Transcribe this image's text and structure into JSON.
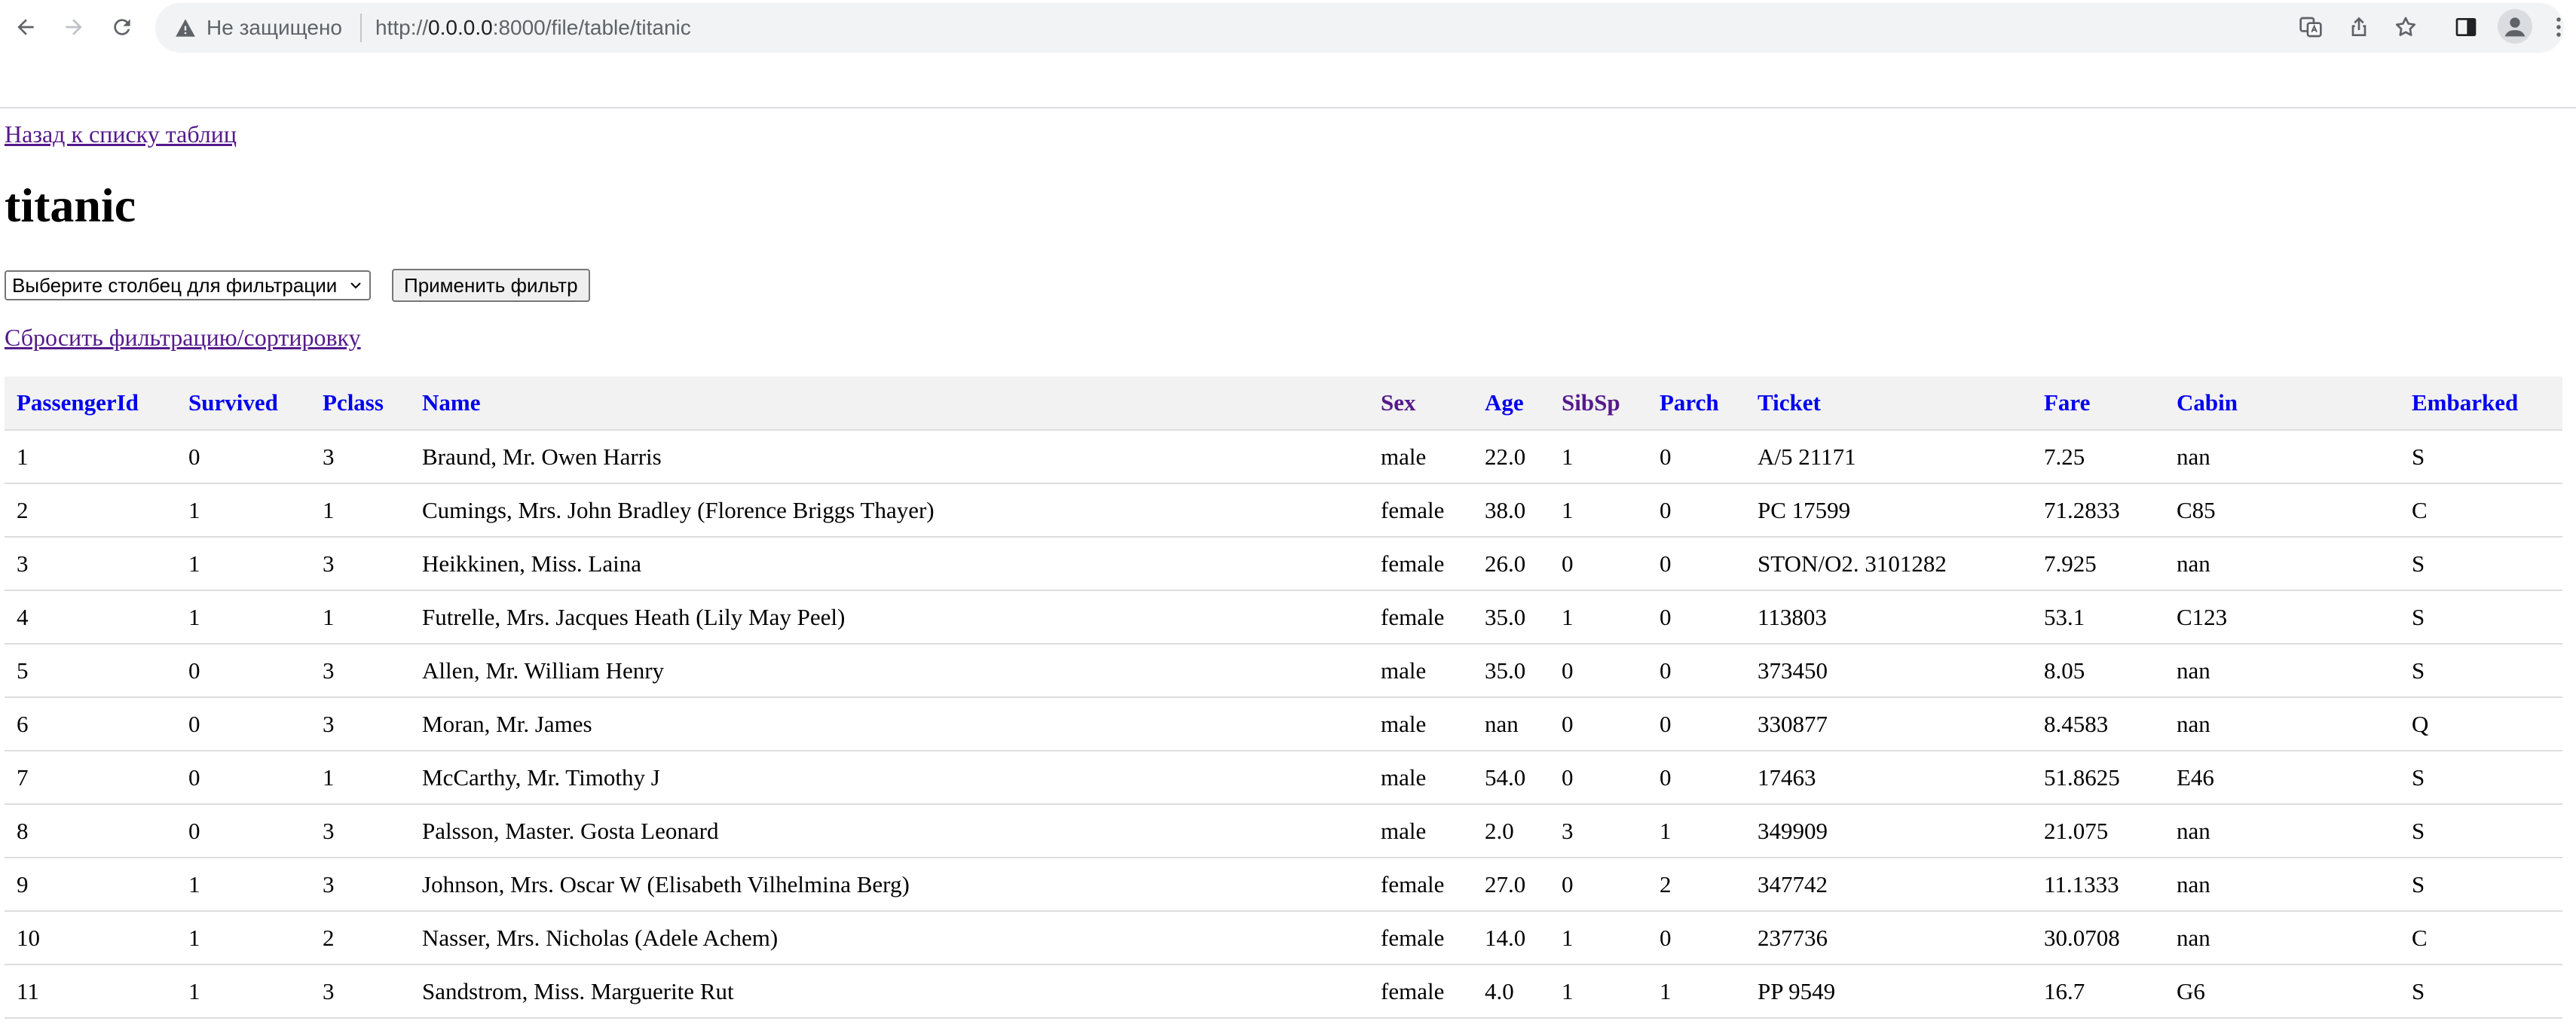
{
  "browser": {
    "security_label": "Не защищено",
    "url_prefix": "http://",
    "url_host": "0.0.0.0",
    "url_path": ":8000/file/table/titanic"
  },
  "page": {
    "back_link": "Назад к списку таблиц",
    "title": "titanic",
    "filter_select": "Выберите столбец для фильтрации",
    "apply_button": "Применить фильтр",
    "reset_link": "Сбросить фильтрацию/сортировку"
  },
  "table": {
    "columns": [
      "PassengerId",
      "Survived",
      "Pclass",
      "Name",
      "Sex",
      "Age",
      "SibSp",
      "Parch",
      "Ticket",
      "Fare",
      "Cabin",
      "Embarked"
    ],
    "rows": [
      [
        "1",
        "0",
        "3",
        "Braund, Mr. Owen Harris",
        "male",
        "22.0",
        "1",
        "0",
        "A/5 21171",
        "7.25",
        "nan",
        "S"
      ],
      [
        "2",
        "1",
        "1",
        "Cumings, Mrs. John Bradley (Florence Briggs Thayer)",
        "female",
        "38.0",
        "1",
        "0",
        "PC 17599",
        "71.2833",
        "C85",
        "C"
      ],
      [
        "3",
        "1",
        "3",
        "Heikkinen, Miss. Laina",
        "female",
        "26.0",
        "0",
        "0",
        "STON/O2. 3101282",
        "7.925",
        "nan",
        "S"
      ],
      [
        "4",
        "1",
        "1",
        "Futrelle, Mrs. Jacques Heath (Lily May Peel)",
        "female",
        "35.0",
        "1",
        "0",
        "113803",
        "53.1",
        "C123",
        "S"
      ],
      [
        "5",
        "0",
        "3",
        "Allen, Mr. William Henry",
        "male",
        "35.0",
        "0",
        "0",
        "373450",
        "8.05",
        "nan",
        "S"
      ],
      [
        "6",
        "0",
        "3",
        "Moran, Mr. James",
        "male",
        "nan",
        "0",
        "0",
        "330877",
        "8.4583",
        "nan",
        "Q"
      ],
      [
        "7",
        "0",
        "1",
        "McCarthy, Mr. Timothy J",
        "male",
        "54.0",
        "0",
        "0",
        "17463",
        "51.8625",
        "E46",
        "S"
      ],
      [
        "8",
        "0",
        "3",
        "Palsson, Master. Gosta Leonard",
        "male",
        "2.0",
        "3",
        "1",
        "349909",
        "21.075",
        "nan",
        "S"
      ],
      [
        "9",
        "1",
        "3",
        "Johnson, Mrs. Oscar W (Elisabeth Vilhelmina Berg)",
        "female",
        "27.0",
        "0",
        "2",
        "347742",
        "11.1333",
        "nan",
        "S"
      ],
      [
        "10",
        "1",
        "2",
        "Nasser, Mrs. Nicholas (Adele Achem)",
        "female",
        "14.0",
        "1",
        "0",
        "237736",
        "30.0708",
        "nan",
        "C"
      ],
      [
        "11",
        "1",
        "3",
        "Sandstrom, Miss. Marguerite Rut",
        "female",
        "4.0",
        "1",
        "1",
        "PP 9549",
        "16.7",
        "G6",
        "S"
      ]
    ]
  },
  "icons": {
    "back": "arrow-left-icon",
    "forward": "arrow-right-icon",
    "reload": "reload-icon",
    "warning": "warning-icon",
    "translate": "translate-icon",
    "share": "share-icon",
    "bookmark": "star-icon",
    "side_panel": "side-panel-icon",
    "profile": "profile-icon",
    "menu": "kebab-menu-icon"
  },
  "colors": {
    "link_visited": "#551a8b",
    "link": "#0000ee",
    "header_bg": "#f2f2f2",
    "row_border": "#dddddd"
  }
}
